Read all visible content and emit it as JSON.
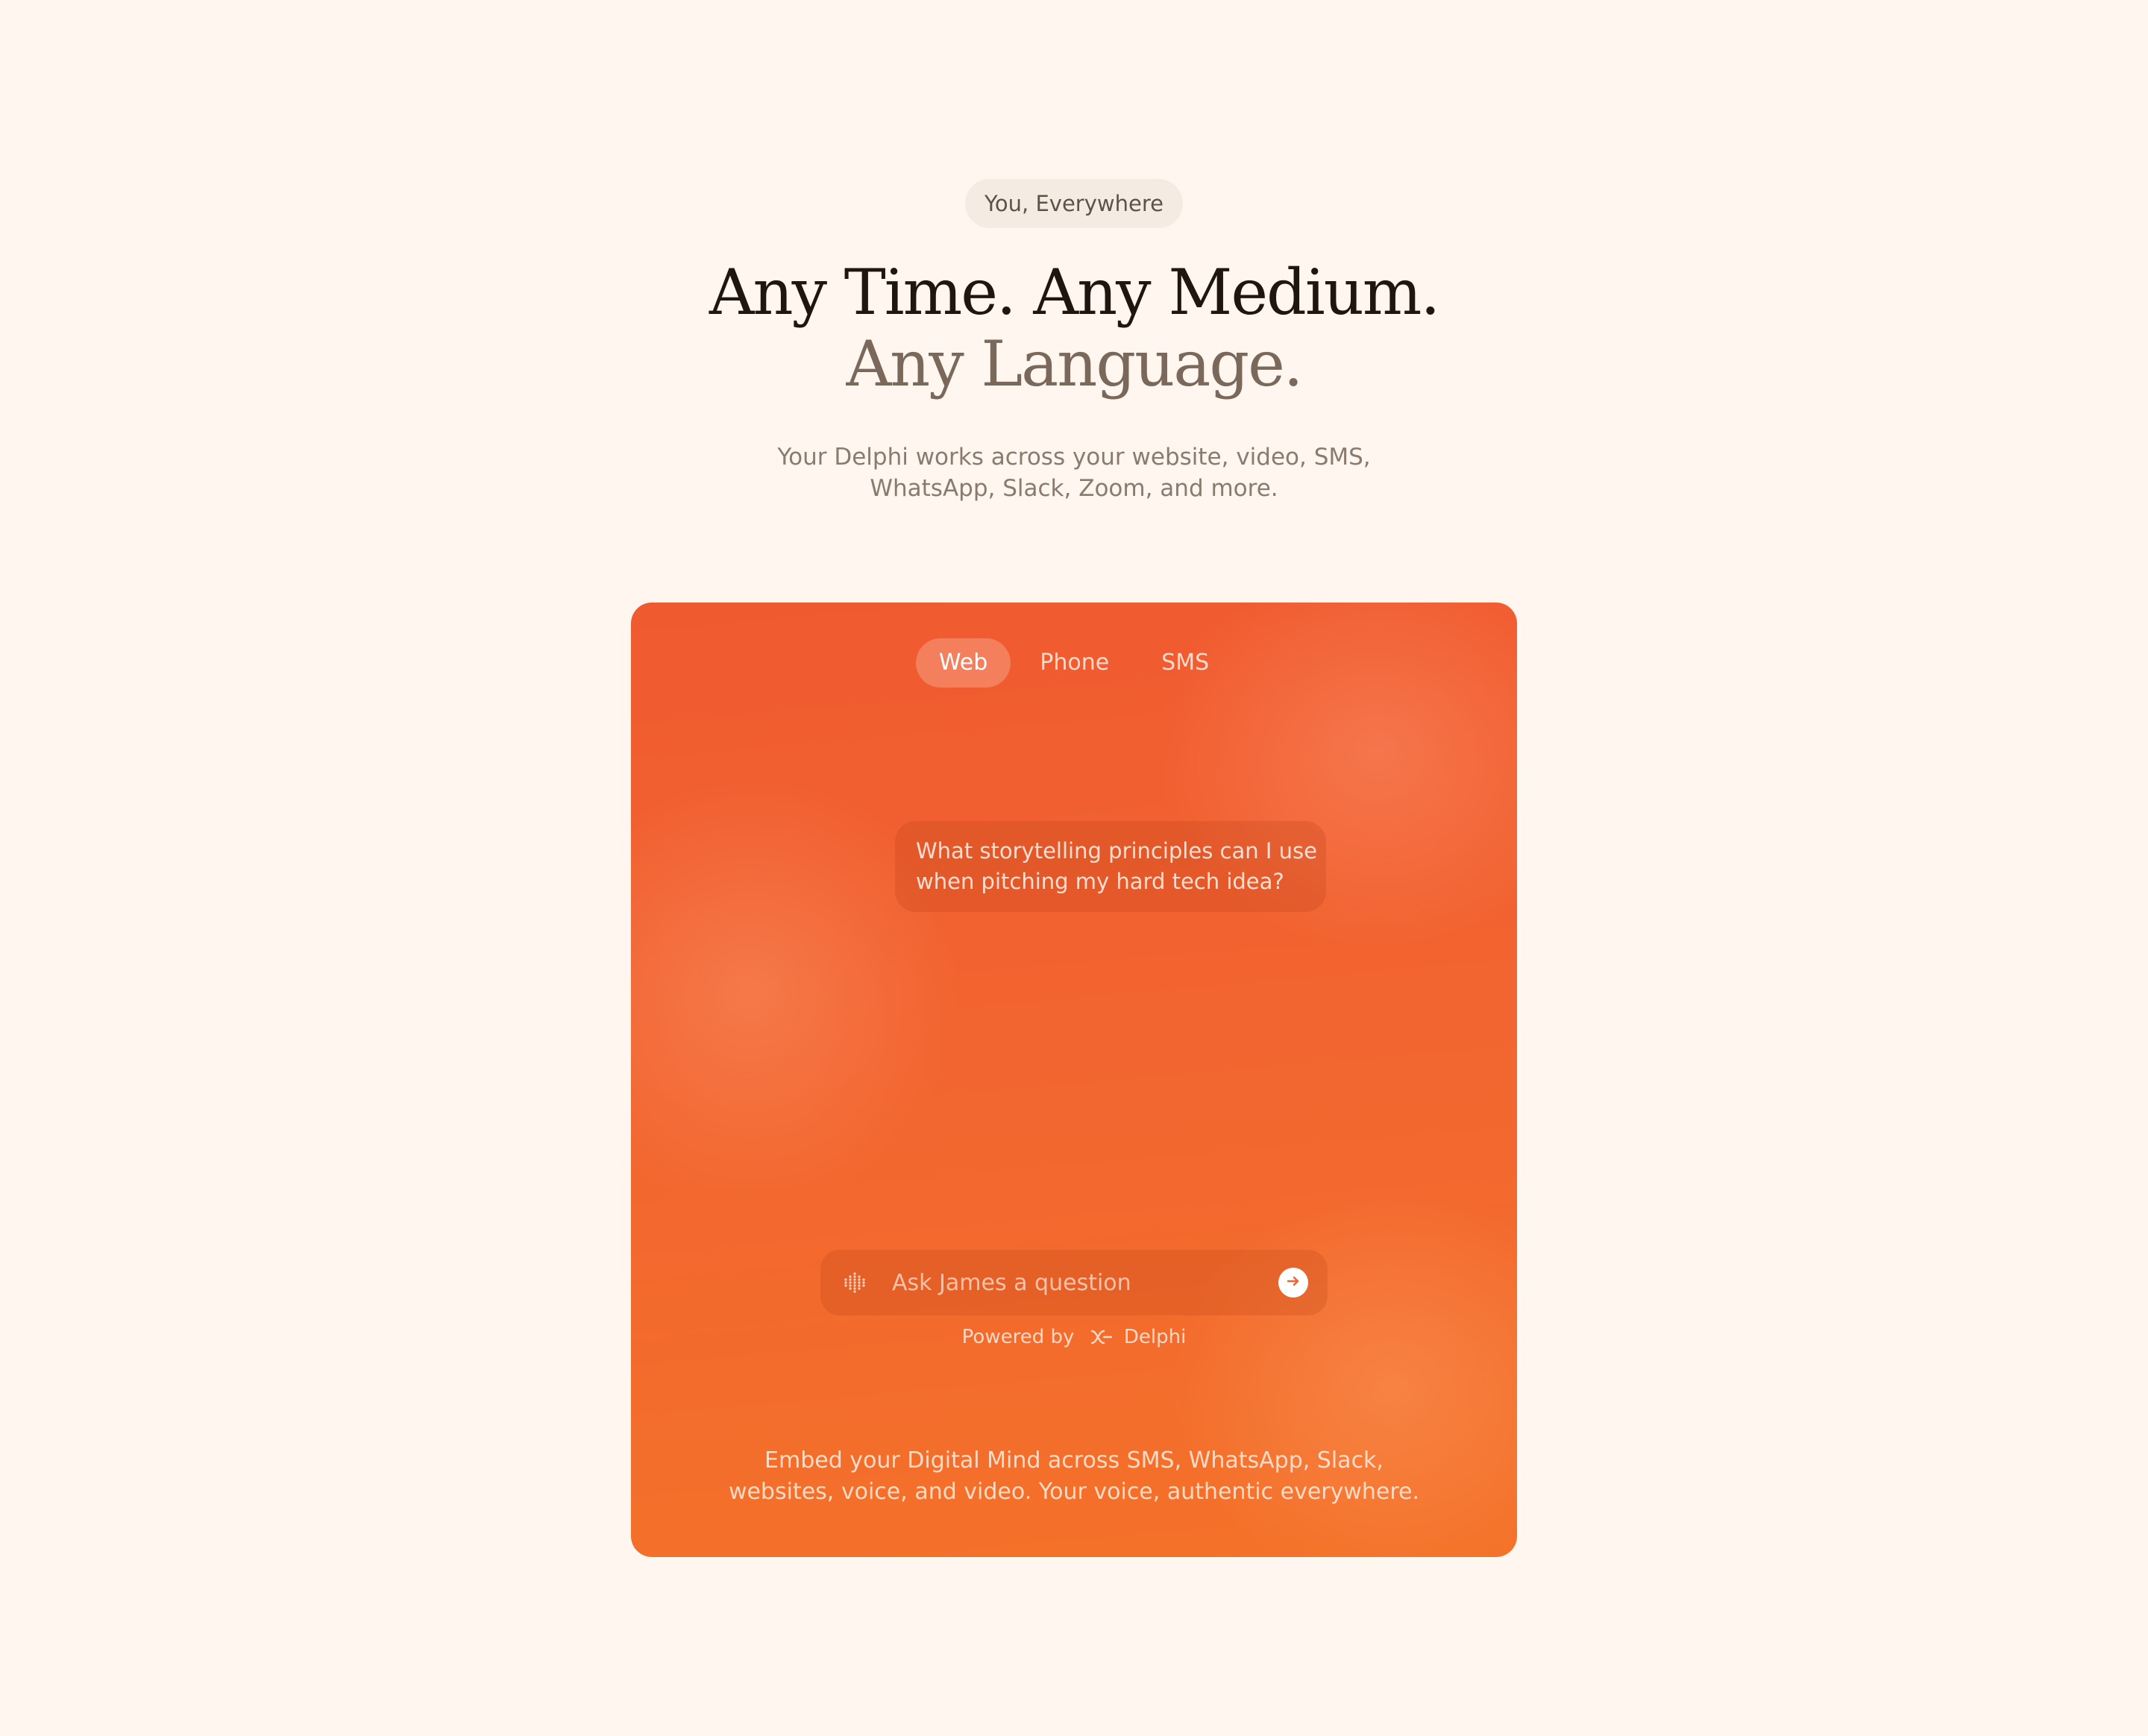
{
  "hero": {
    "badge": "You, Everywhere",
    "headline_line1": "Any Time. Any Medium.",
    "headline_line2": "Any Language.",
    "subtext_line1": "Your Delphi works across your website, video, SMS,",
    "subtext_line2": "WhatsApp, Slack, Zoom, and more."
  },
  "demo": {
    "tabs": [
      {
        "label": "Web",
        "active": true
      },
      {
        "label": "Phone",
        "active": false
      },
      {
        "label": "SMS",
        "active": false
      }
    ],
    "message_line1": "What storytelling principles can I use",
    "message_line2": "when pitching my hard tech idea?",
    "input_placeholder": "Ask James a question",
    "powered_by_label": "Powered by",
    "brand_name": "Delphi",
    "embed_line1": "Embed your Digital Mind across SMS, WhatsApp, Slack,",
    "embed_line2": "websites, voice, and video. Your voice, authentic everywhere."
  },
  "icons": {
    "mic": "waveform-dots-icon",
    "send": "arrow-right-icon",
    "brand": "delphi-logo-icon"
  },
  "colors": {
    "page_background": "#FEF6EF",
    "accent_orange": "#F26430",
    "headline_dark": "#21160F",
    "headline_muted": "#7A695B"
  }
}
